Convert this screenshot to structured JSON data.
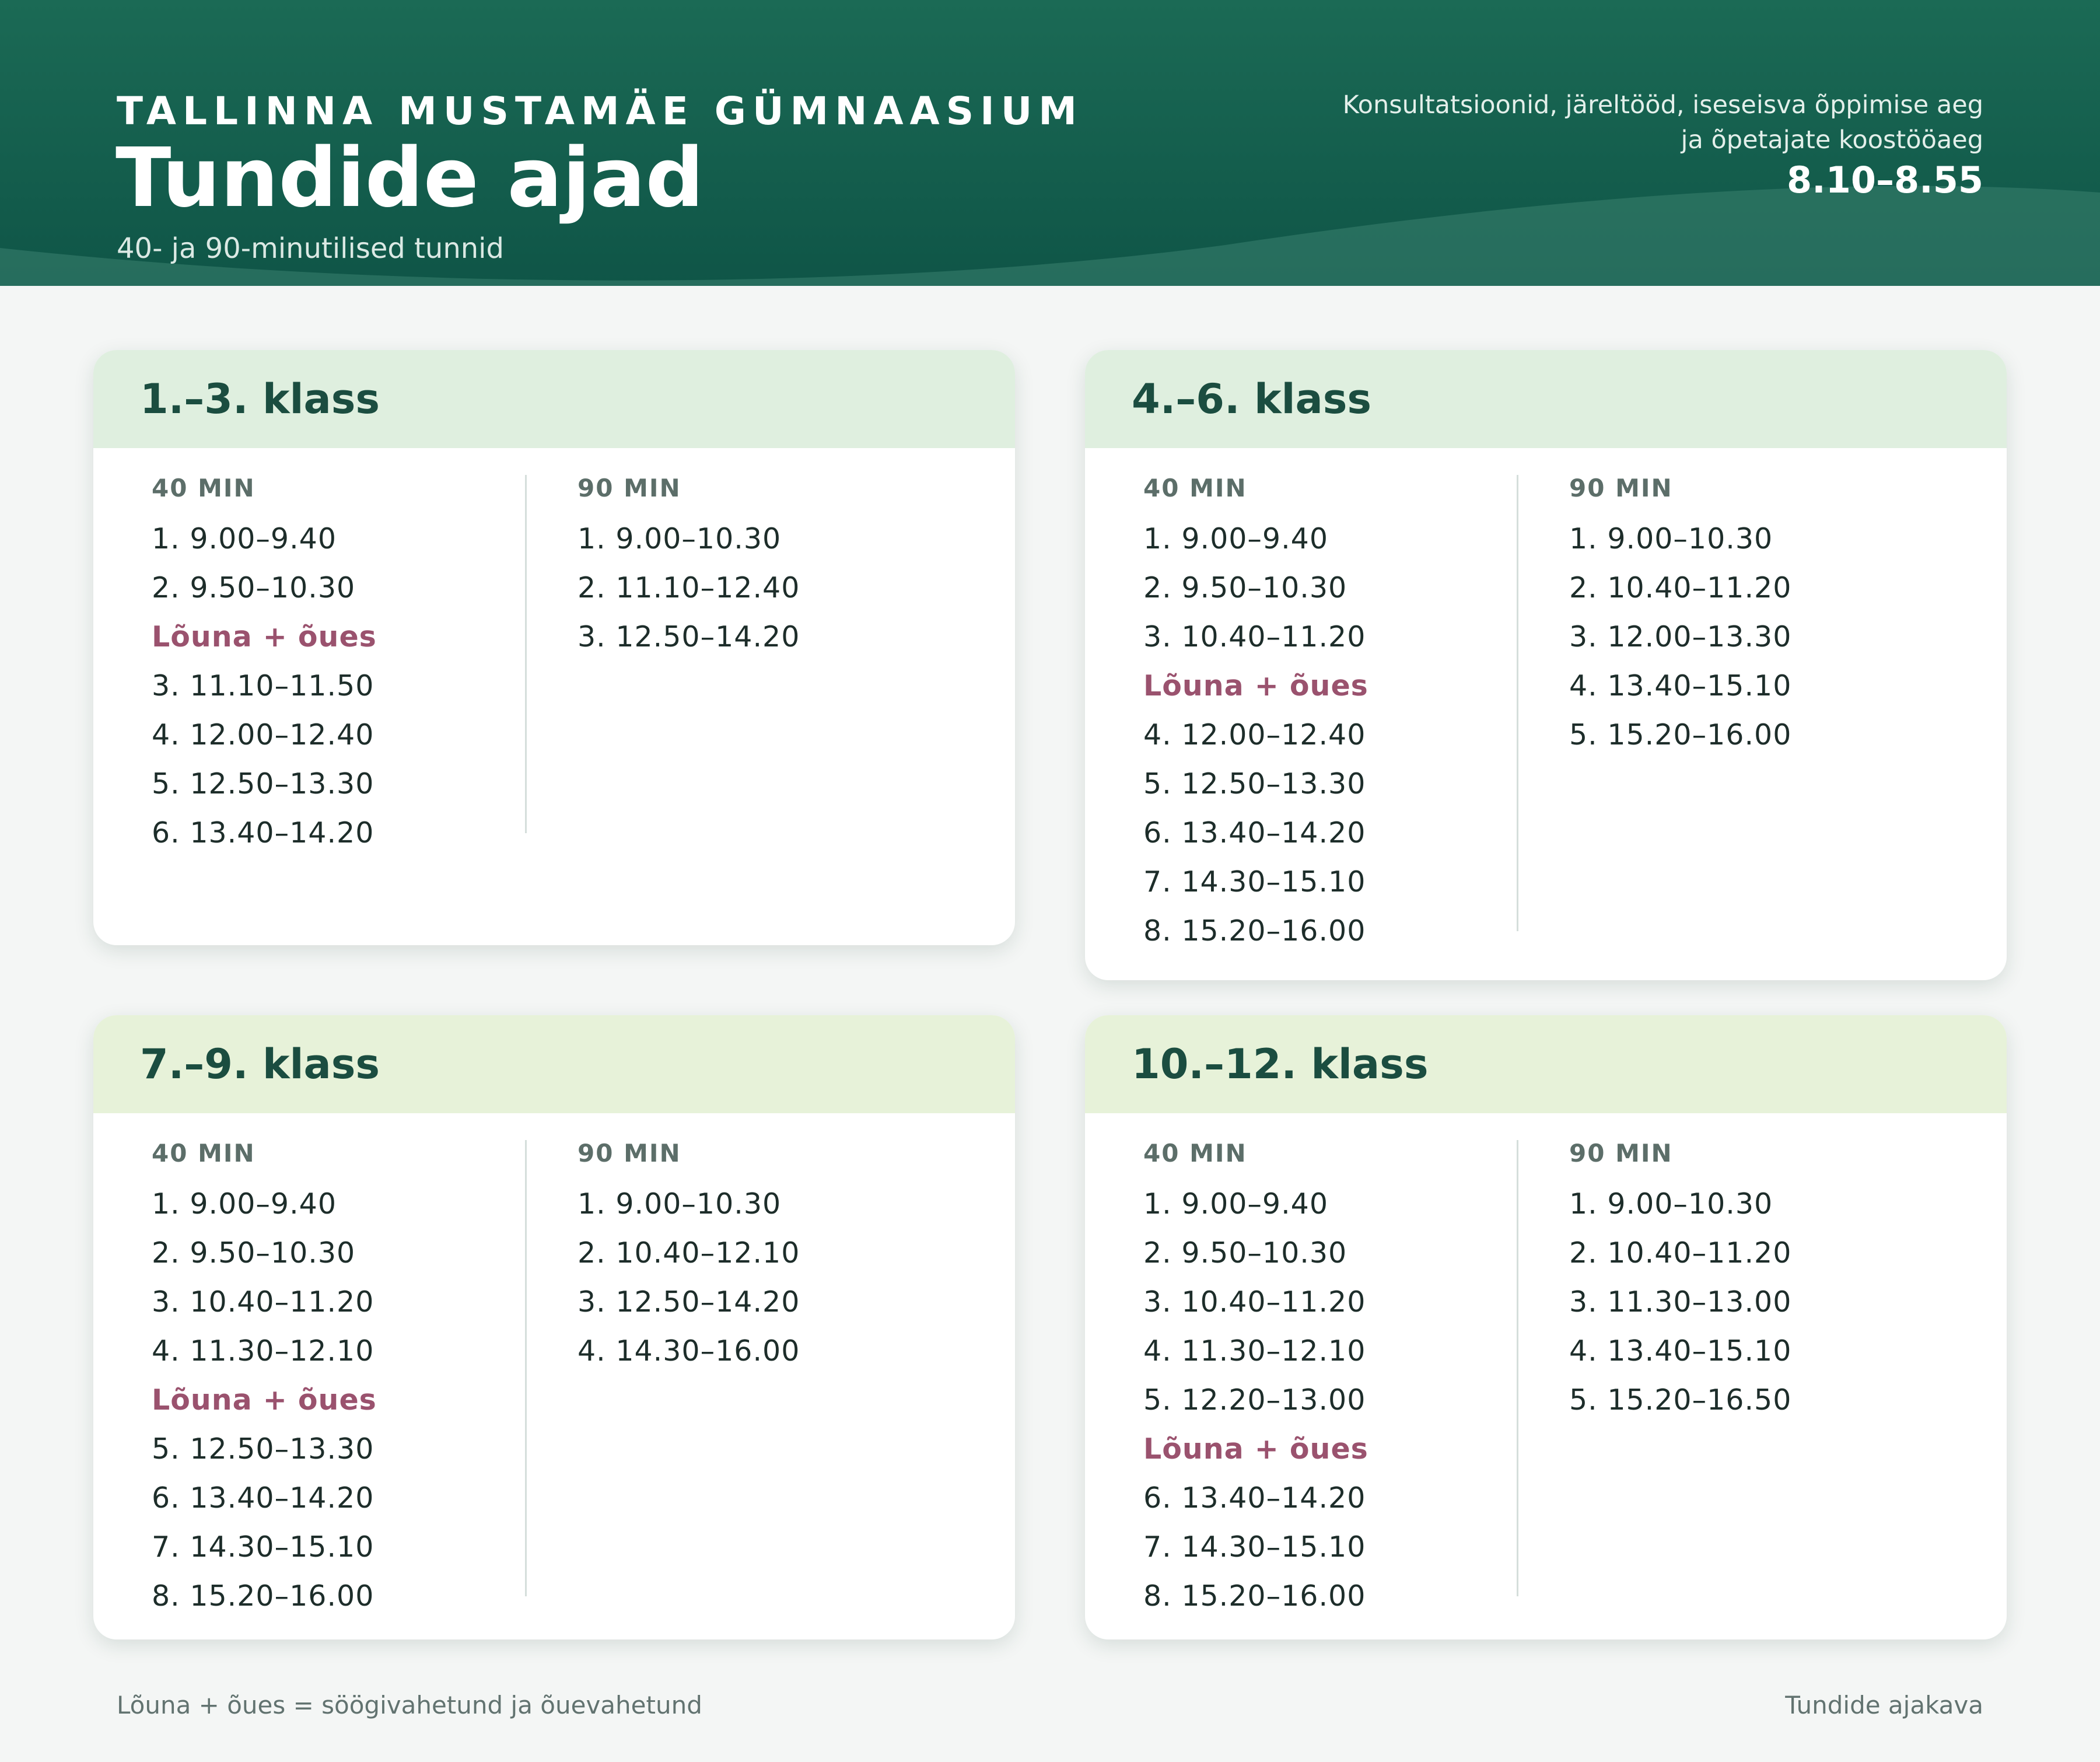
{
  "header": {
    "school": "TALLINNA MUSTAMÄE GÜMNAASIUM",
    "title": "Tundide ajad",
    "subtitle": "40- ja 90-minutilised tunnid",
    "consult_line1": "Konsultatsioonid, järeltööd, iseseisva õppimise aeg",
    "consult_line2": "ja õpetajate koostööaeg",
    "consult_time": "8.10–8.55"
  },
  "columns": {
    "short": "40 MIN",
    "long": "90 MIN"
  },
  "cards": [
    {
      "title": "1.–3. klass",
      "col40": [
        "1. 9.00–9.40",
        "2. 9.50–10.30",
        "Lõuna + õues",
        "3. 11.10–11.50",
        "4. 12.00–12.40",
        "5. 12.50–13.30",
        "6. 13.40–14.20"
      ],
      "col90": [
        "1. 9.00–10.30",
        "2. 11.10–12.40",
        "3. 12.50–14.20"
      ]
    },
    {
      "title": "4.–6. klass",
      "col40": [
        "1. 9.00–9.40",
        "2. 9.50–10.30",
        "3. 10.40–11.20",
        "Lõuna + õues",
        "4. 12.00–12.40",
        "5. 12.50–13.30",
        "6. 13.40–14.20",
        "7. 14.30–15.10",
        "8. 15.20–16.00"
      ],
      "col90": [
        "1. 9.00–10.30",
        "2. 10.40–11.20",
        "3. 12.00–13.30",
        "4. 13.40–15.10",
        "5. 15.20–16.00"
      ]
    },
    {
      "title": "7.–9. klass",
      "col40": [
        "1. 9.00–9.40",
        "2. 9.50–10.30",
        "3. 10.40–11.20",
        "4. 11.30–12.10",
        "Lõuna + õues",
        "5. 12.50–13.30",
        "6. 13.40–14.20",
        "7. 14.30–15.10",
        "8. 15.20–16.00"
      ],
      "col90": [
        "1. 9.00–10.30",
        "2. 10.40–12.10",
        "3. 12.50–14.20",
        "4. 14.30–16.00"
      ]
    },
    {
      "title": "10.–12. klass",
      "col40": [
        "1. 9.00–9.40",
        "2. 9.50–10.30",
        "3. 10.40–11.20",
        "4. 11.30–12.10",
        "5. 12.20–13.00",
        "Lõuna + õues",
        "6. 13.40–14.20",
        "7. 14.30–15.10",
        "8. 15.20–16.00"
      ],
      "col90": [
        "1. 9.00–10.30",
        "2. 10.40–11.20",
        "3. 11.30–13.00",
        "4. 13.40–15.10",
        "5. 15.20–16.50"
      ]
    }
  ],
  "lunch_label": "Lõuna + õues",
  "footer": {
    "legend": "Lõuna + õues = söögivahetund ja õuevahetund",
    "right": "Tundide ajakava"
  },
  "colors": {
    "header": "#14614f",
    "card_head_1": "#dfefdf",
    "card_head_2": "#e7f2d9",
    "lunch": "#9a526e",
    "card_title": "#1b4d40"
  }
}
